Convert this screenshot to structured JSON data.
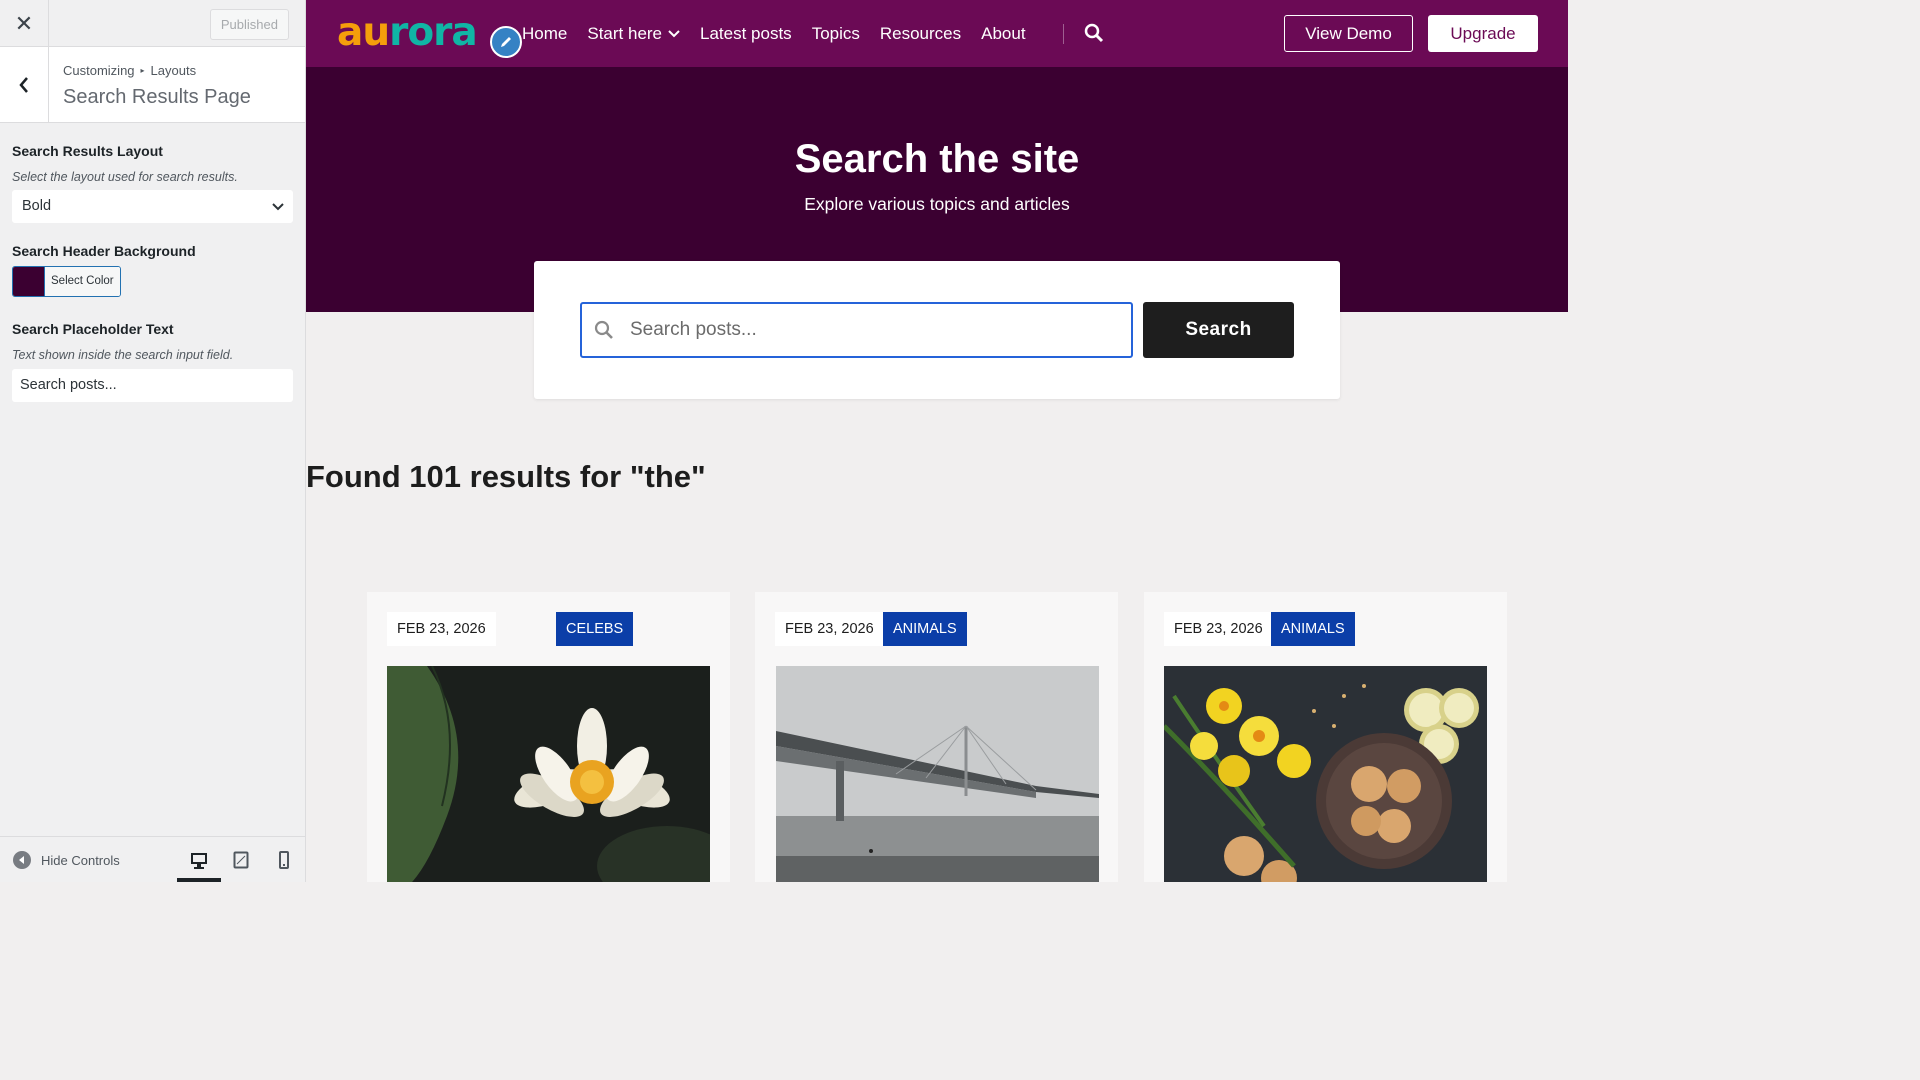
{
  "customizer": {
    "published_label": "Published",
    "breadcrumb_root": "Customizing",
    "breadcrumb_section": "Layouts",
    "panel_title": "Search Results Page",
    "controls": {
      "layout_label": "Search Results Layout",
      "layout_desc": "Select the layout used for search results.",
      "layout_value": "Bold",
      "bg_label": "Search Header Background",
      "bg_color": "#3b0031",
      "bg_button": "Select Color",
      "placeholder_label": "Search Placeholder Text",
      "placeholder_desc": "Text shown inside the search input field.",
      "placeholder_value": "Search posts..."
    },
    "footer": {
      "hide_controls": "Hide Controls",
      "devices": [
        "desktop-icon",
        "tablet-icon",
        "mobile-icon"
      ],
      "active_device": "desktop"
    }
  },
  "site": {
    "logo": {
      "part1": "au",
      "part2": "rora"
    },
    "nav": [
      "Home",
      "Start here",
      "Latest posts",
      "Topics",
      "Resources",
      "About"
    ],
    "view_demo": "View Demo",
    "upgrade": "Upgrade",
    "colors": {
      "topbar": "#6b0a55",
      "hero": "#3b0031",
      "category": "#0b3ea8"
    }
  },
  "hero": {
    "title": "Search the site",
    "subtitle": "Explore various topics and articles",
    "search_placeholder": "Search posts...",
    "search_button": "Search"
  },
  "results": {
    "heading": "Found 101 results for \"the\"",
    "cards": [
      {
        "date": "FEB 23, 2026",
        "category": "CELEBS",
        "image": "water-lily"
      },
      {
        "date": "FEB 23, 2026",
        "category": "ANIMALS",
        "image": "foggy-bridge"
      },
      {
        "date": "FEB 23, 2026",
        "category": "ANIMALS",
        "image": "daffodils-cookies"
      }
    ]
  }
}
